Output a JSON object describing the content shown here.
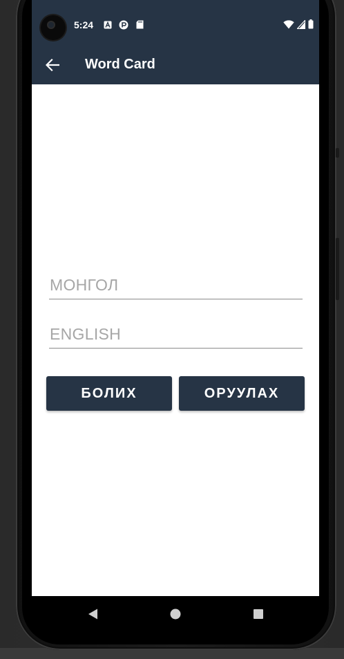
{
  "status_bar": {
    "time": "5:24",
    "notification_icons": [
      "a-badge-icon",
      "circle-app-icon",
      "sd-card-icon"
    ],
    "system_icons": [
      "wifi-icon",
      "signal-icon",
      "battery-icon"
    ]
  },
  "app_bar": {
    "title": "Word Card",
    "back_icon": "arrow-left-icon"
  },
  "form": {
    "mongol_placeholder": "МОНГОЛ",
    "mongol_value": "",
    "english_placeholder": "ENGLISH",
    "english_value": ""
  },
  "buttons": {
    "cancel_label": "БОЛИХ",
    "insert_label": "ОРУУЛАХ"
  },
  "nav_bar": {
    "icons": [
      "back-triangle-icon",
      "home-circle-icon",
      "recents-square-icon"
    ]
  },
  "colors": {
    "primary": "#263445",
    "background": "#ffffff",
    "placeholder": "#a6a6a6",
    "underline": "#8a8a8a"
  }
}
